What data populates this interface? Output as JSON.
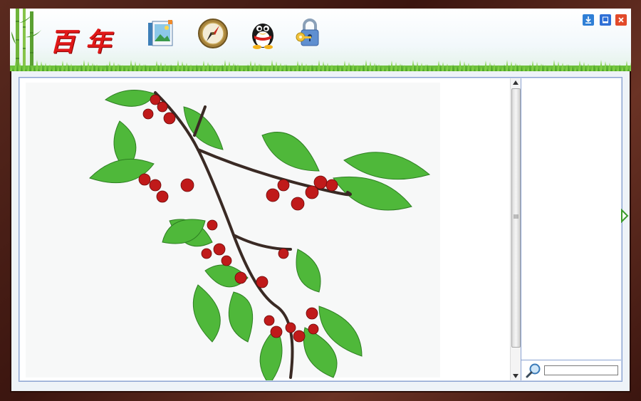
{
  "app": {
    "logo_text": "百年"
  },
  "toolbar": {
    "tools": [
      {
        "name": "gallery-book",
        "icon": "picture-book-icon"
      },
      {
        "name": "compass",
        "icon": "compass-icon"
      },
      {
        "name": "qq",
        "icon": "penguin-icon"
      },
      {
        "name": "lock",
        "icon": "lock-key-icon"
      }
    ]
  },
  "window_controls": [
    "download-icon",
    "minimize-icon",
    "close-icon"
  ],
  "main": {
    "image_subject": "cherry-branch"
  },
  "search": {
    "value": "",
    "icon": "magnifier-icon"
  },
  "colors": {
    "frame": "#4a1c12",
    "accent_blue": "#2f6fd6",
    "close_red": "#e24a2a",
    "logo_red": "#e01818",
    "border_blue": "#8aa2d2"
  }
}
